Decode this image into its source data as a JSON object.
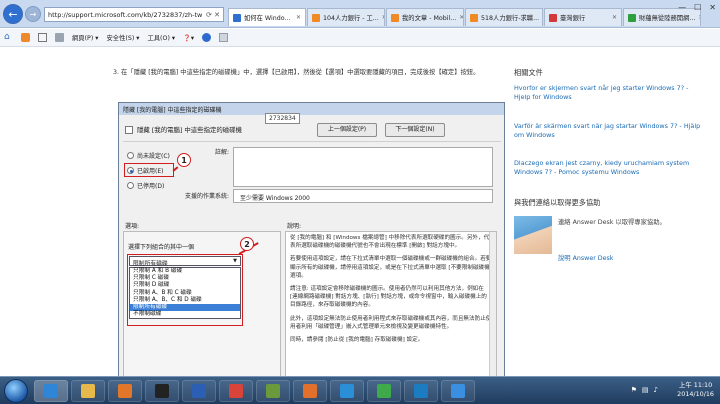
{
  "browser": {
    "address": "http://support.microsoft.com/kb/2732837/zh-tw",
    "tabs": [
      {
        "label": "如何在 Windo...",
        "color": "#2e6fcf",
        "active": true
      },
      {
        "label": "104人力銀行 - 工...",
        "color": "#f08a24",
        "active": false
      },
      {
        "label": "我的文章 - Mobil...",
        "color": "#f08a24",
        "active": false
      },
      {
        "label": "518人力銀行-求職...",
        "color": "#f08a24",
        "active": false
      },
      {
        "label": "臺灣銀行",
        "color": "#d23a3a",
        "active": false
      },
      {
        "label": "財蘊無從陸務開網...",
        "color": "#2e9f3e",
        "active": false
      }
    ],
    "window_controls": {
      "minimize": "—",
      "maximize": "☐",
      "close": "✕"
    },
    "command_bar": {
      "page": "網頁(P) ▾",
      "safety": "安全性(S) ▾",
      "tools": "工具(O) ▾",
      "help": "❓▾"
    }
  },
  "article": {
    "step_text": "3. 在「隱藏 [我的電腦] 中這些指定的磁碟機」中，選擇【已啟用】，然後從【選項】中選取要隱藏的項目，完成後按【確定】按鈕。"
  },
  "screenshot": {
    "window_title": "隱藏 [我的電腦] 中這些指定的磁碟機",
    "heading": "隱藏 [我的電腦] 中這些指定的磁碟機",
    "tooltip": "2732834",
    "prev_button": "上一個設定(P)",
    "next_button": "下一個設定(N)",
    "radios": [
      {
        "label": "尚未設定(C)",
        "checked": false
      },
      {
        "label": "已啟用(E)",
        "checked": true
      },
      {
        "label": "已停用(D)",
        "checked": false
      }
    ],
    "comment_label": "註解:",
    "supported_label": "支援的作業系統:",
    "supported_value": "至少需要 Windows 2000",
    "options_label": "選項:",
    "help_label": "說明:",
    "combo_label": "選擇下列組合的其中一個",
    "combo_value": "限制所有磁碟",
    "options_list": [
      {
        "label": "只限制 A 和 B 磁碟",
        "selected": false
      },
      {
        "label": "只限制 C 磁碟",
        "selected": false
      },
      {
        "label": "只限制 D 磁碟",
        "selected": false
      },
      {
        "label": "只限制 A、B 和 C 磁碟",
        "selected": false
      },
      {
        "label": "只限制 A、B、C 和 D 磁碟",
        "selected": false
      },
      {
        "label": "限制所有磁碟",
        "selected": true
      },
      {
        "label": "不限制磁碟",
        "selected": false
      }
    ],
    "help_paragraphs": [
      "從 [我的電腦] 和 [Windows 檔案總管] 中移除代表所選取硬碟的圖示。另外，代表所選取磁碟機的磁碟機代號也不會出現在標準 [開啟] 對話方塊中。",
      "若要使用這項設定，請在下拉式清單中選取一個磁碟機或一群磁碟機的組合。若要顯示所有的磁碟機，請停用這項設定，或是在下拉式清單中選取 [不要限制磁碟機] 選項。",
      "請注意: 這項設定會移除磁碟機的圖示。使用者仍然可以利用其他方法，例如在 [連線網路磁碟機] 對話方塊、[執行] 對話方塊，或命令視窗中，輸入磁碟機上的目錄路徑，來存取磁碟機的內容。",
      "此外，這項設定無法防止使用者利用程式來存取磁碟機或其內容，而且無法防止使用者利用「磁碟管理」嵌入式管理單元來檢視及變更磁碟機特性。",
      "同時，請參閱 [防止從 [我的電腦] 存取磁碟機] 設定。"
    ],
    "callouts": [
      "1",
      "2"
    ]
  },
  "sidebar": {
    "related_heading": "相關文件",
    "related_links": [
      "Hvorfor er skjermen svart når jeg starter Windows 7? - Hjelp for Windows",
      "Varför är skärmen svart när jag startar Windows 7? - Hjälp om Windows",
      "Dlaczego ekran jest czarny, kiedy uruchamiam system Windows 7? - Pomoc systemu Windows"
    ],
    "contact_heading": "與我們連絡以取得更多協助",
    "agent_text": "連絡 Answer Desk 以取得專家協助。",
    "agent_link": "說明 Answer Desk"
  },
  "taskbar": {
    "apps": [
      {
        "name": "ie",
        "color": "#2f86d6"
      },
      {
        "name": "explorer",
        "color": "#e6b94a"
      },
      {
        "name": "media-player",
        "color": "#e2772a"
      },
      {
        "name": "cmd",
        "color": "#222222"
      },
      {
        "name": "word",
        "color": "#2b5fb4"
      },
      {
        "name": "chrome",
        "color": "#d9443a"
      },
      {
        "name": "photos",
        "color": "#6a9a3c"
      },
      {
        "name": "firefox",
        "color": "#e0702b"
      },
      {
        "name": "video",
        "color": "#2b8fd8"
      },
      {
        "name": "green-app",
        "color": "#3faa4a"
      },
      {
        "name": "media",
        "color": "#1c7cc2"
      },
      {
        "name": "ie-pinned",
        "color": "#3a8fe0"
      }
    ],
    "time": "上午 11:10",
    "date": "2014/10/16"
  }
}
